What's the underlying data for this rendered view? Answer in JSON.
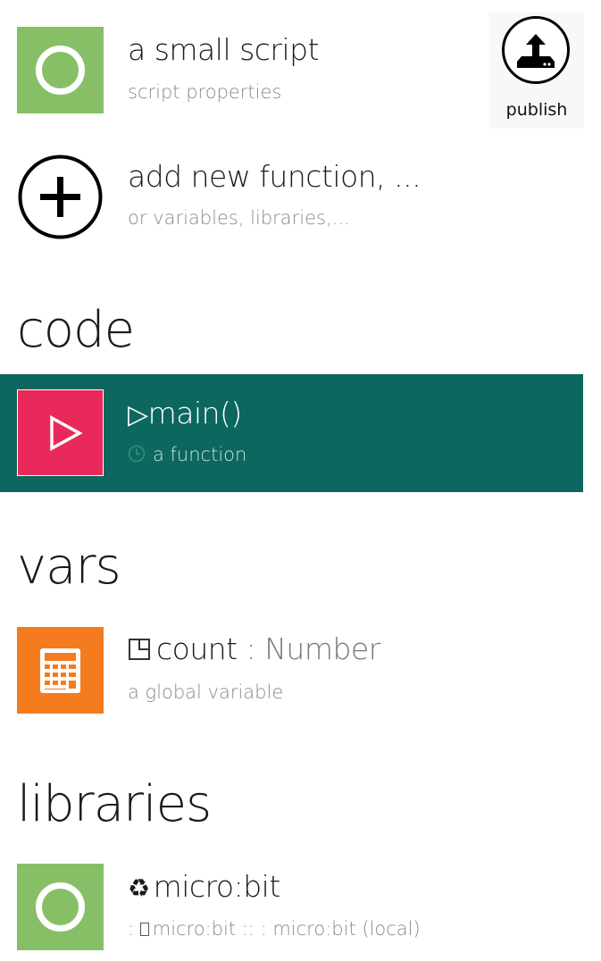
{
  "script": {
    "title": "a small script",
    "subtitle": "script properties"
  },
  "toolbar": {
    "publish_label": "publish"
  },
  "add_new": {
    "title": "add new function, ...",
    "subtitle": "or variables, libraries,..."
  },
  "sections": {
    "code": "code",
    "vars": "vars",
    "libraries": "libraries"
  },
  "functions": [
    {
      "glyph": "▷",
      "name": "main()",
      "description": "a function"
    }
  ],
  "variables": [
    {
      "name": "count",
      "type_sep": " : ",
      "type": "Number",
      "description": "a global variable"
    }
  ],
  "libraries": [
    {
      "glyph": "♻",
      "name": "micro:bit",
      "prefix": ": ",
      "description": "micro:bit :: : micro:bit (local)"
    }
  ],
  "colors": {
    "script_tile": "#87bf66",
    "function_tile": "#e8295a",
    "selected_row": "#0c675e",
    "variable_tile": "#f57c1e",
    "library_tile": "#87bf66"
  },
  "icons": {
    "script": "ring-icon",
    "publish": "upload-icon",
    "add": "plus-circle-icon",
    "function": "play-icon",
    "function_meta": "clock-icon",
    "variable": "calculator-icon",
    "variable_type": "box-icon",
    "library": "ring-icon",
    "library_name": "recycle-icon",
    "library_meta": "rectangle-icon"
  }
}
